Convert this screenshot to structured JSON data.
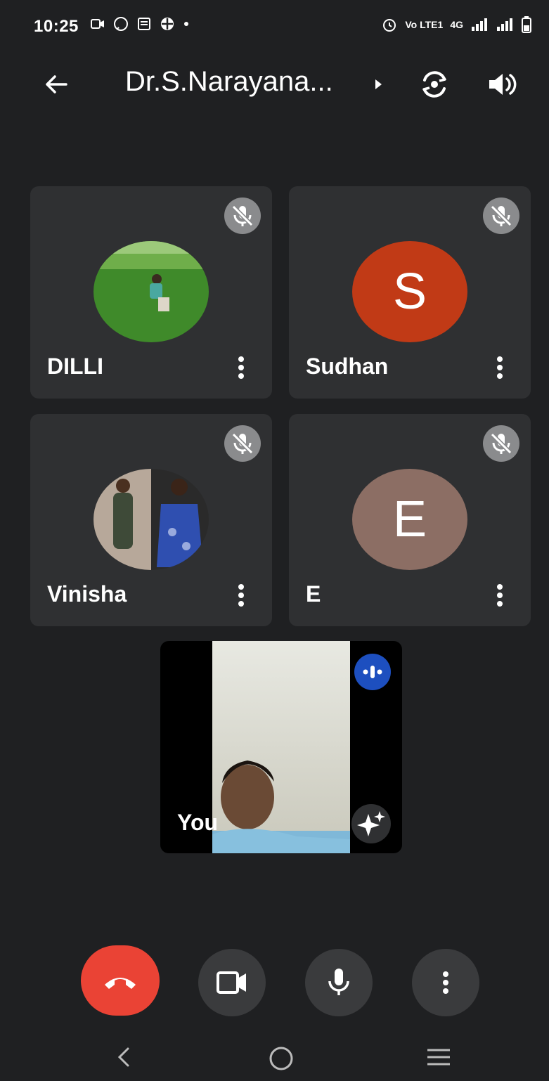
{
  "status_bar": {
    "time": "10:25",
    "network_label": "4G",
    "volte_label": "Vo LTE1"
  },
  "header": {
    "title": "Dr.S.Narayana..."
  },
  "participants": [
    {
      "name": "DILLI",
      "avatar_type": "photo",
      "muted": true
    },
    {
      "name": "Sudhan",
      "avatar_type": "letter",
      "letter": "S",
      "avatar_color": "#c13a16",
      "muted": true
    },
    {
      "name": "Vinisha",
      "avatar_type": "photo",
      "muted": true
    },
    {
      "name": "E",
      "avatar_type": "letter",
      "letter": "E",
      "avatar_color": "#8c6e64",
      "muted": true
    }
  ],
  "self_view": {
    "label": "You",
    "speaking": true
  },
  "controls": {
    "end_call_color": "#ea4335",
    "icons": [
      "end-call-icon",
      "camera-icon",
      "microphone-icon",
      "more-options-icon"
    ]
  },
  "colors": {
    "background": "#1f2022",
    "tile": "#2f3032",
    "speaking_indicator": "#1d4fbf"
  }
}
